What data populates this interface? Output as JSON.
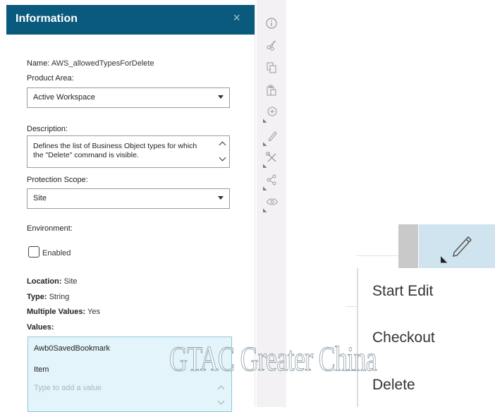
{
  "panel": {
    "title": "Information",
    "close_glyph": "×",
    "name_label": "Name:",
    "name_value": "AWS_allowedTypesForDelete",
    "product_area_label": "Product Area:",
    "product_area_value": "Active Workspace",
    "description_label": "Description:",
    "description_value": "Defines the list of Business Object types for which the \"Delete\" command is visible.",
    "protection_scope_label": "Protection Scope:",
    "protection_scope_value": "Site",
    "environment_label": "Environment:",
    "enabled_label": "Enabled",
    "enabled_checked": false,
    "location_label": "Location:",
    "location_value": "Site",
    "type_label": "Type:",
    "type_value": "String",
    "multiple_values_label": "Multiple Values:",
    "multiple_values_value": "Yes",
    "values_label": "Values:",
    "values": [
      "Awb0SavedBookmark",
      "Item"
    ],
    "value_placeholder": "Type to add a value"
  },
  "toolbar": {
    "icons": [
      "info-icon",
      "cut-icon",
      "copy-icon",
      "paste-icon",
      "add-icon",
      "edit-icon",
      "tools-icon",
      "share-icon",
      "view-icon"
    ]
  },
  "context_menu": {
    "items": [
      "Start Edit",
      "Checkout",
      "Delete"
    ]
  },
  "watermark": "GTAC Greater China",
  "colors": {
    "header": "#0a5a7d",
    "values_bg": "#e3f4fb",
    "edit_button_bg": "#cfe4ee",
    "toolbar_bg": "#f4f1f4"
  }
}
